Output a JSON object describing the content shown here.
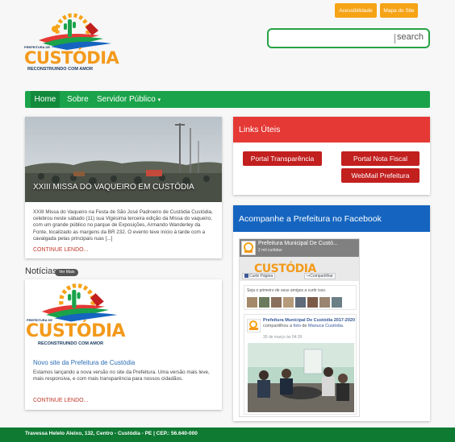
{
  "top_links": {
    "accessibility": "Acessibilidade",
    "sitemap": "Mapa do Site"
  },
  "logo": {
    "prefix": "PREFEITURA DE",
    "name": "CUSTÓDIA",
    "tagline": "RECONSTRUINDO COM AMOR"
  },
  "search": {
    "button": "search",
    "placeholder": ""
  },
  "nav": {
    "items": [
      "Home",
      "Sobre",
      "Servidor Público"
    ],
    "dropdown_glyph": "▾"
  },
  "featured": {
    "overlay_title": "XXIII MISSA DO VAQUEIRO EM CUSTÓDIA",
    "text": "XXIII Missa do Vaqueiro na Festa de São José Padroeiro de Custódia Custódia, celebrou neste sábado (11) sua Vigésima terceira edição da Missa do vaqueiro, com um grande público no parque de Exposições, Armando Wanderley da Fonte, localizado as margens da BR 232. O evento teve início à tarde com a cavalgada pelas principais ruas [...]",
    "more": "CONTINUE LENDO..."
  },
  "news": {
    "heading": "Notícias",
    "see_more": "Ver Mais",
    "title": "Novo site da Prefeitura de Custódia",
    "text": "Estamos lançando a nova versão no site da Prefeitura. Uma versão mais leve, mais responsiva, e com mais transparência para nossos cidadãos.",
    "more": "CONTINUE LENDO..."
  },
  "links_uteis": {
    "title": "Links Úteis",
    "buttons": [
      "Portal Transparência",
      "Portal Nota Fiscal",
      "WebMail Prefeitura"
    ]
  },
  "facebook": {
    "title": "Acompanhe a Prefeitura no Facebook",
    "page_name": "Prefeitura Municipal De Custó...",
    "likes": "2 mil curtidas",
    "like_button": "Curtir Página",
    "share_button": "Compartilhar",
    "friends_text": "Seja o primeiro de seus amigos a curtir isso.",
    "post_title": "Prefeitura Municipal De Custódia 2017-2020",
    "post_action": "compartilhou a",
    "post_link": "foto",
    "post_of": "de",
    "post_author": "Manuca Custódia.",
    "post_date": "30 de março às 04:39"
  },
  "footer": {
    "address": "Travessa Helelo Aleixo, 132, Centro - Custódia - PE | CEP.: 56.640-000"
  },
  "colors": {
    "green": "#1aa34a",
    "orange": "#f6a316",
    "red": "#e53935",
    "blue": "#1565c0",
    "dark_red": "#c21f1f"
  }
}
